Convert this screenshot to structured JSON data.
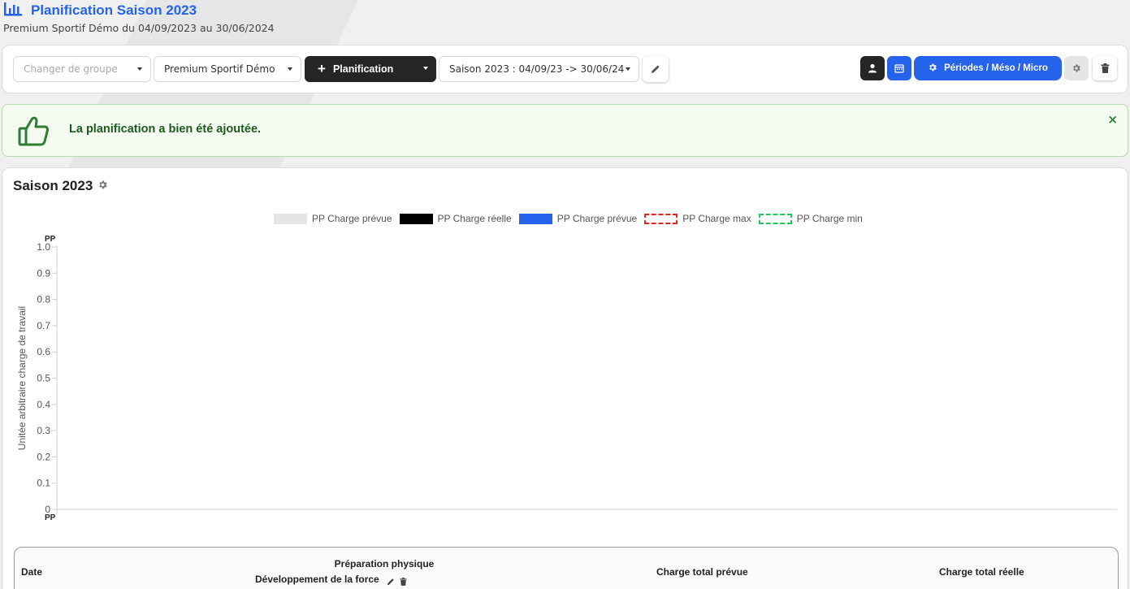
{
  "header": {
    "title": "Planification Saison 2023",
    "subtitle": "Premium Sportif Démo du 04/09/2023 au 30/06/2024"
  },
  "toolbar": {
    "group_select_placeholder": "Changer de groupe",
    "team_select_value": "Premium Sportif Démo",
    "planification_button_label": "Planification",
    "season_select_value": "Saison 2023 : 04/09/23 -> 30/06/24",
    "periods_button_label": "Périodes / Méso / Micro"
  },
  "alert": {
    "message": "La planification a bien été ajoutée.",
    "close_symbol": "×"
  },
  "card": {
    "title": "Saison 2023"
  },
  "chart_data": {
    "type": "bar",
    "title": "",
    "xlabel": "",
    "ylabel": "Unitée arbitraire charge de travail",
    "ylim": [
      0,
      1.0
    ],
    "y_ticks": [
      "0",
      "0.1",
      "0.2",
      "0.3",
      "0.4",
      "0.5",
      "0.6",
      "0.7",
      "0.8",
      "0.9",
      "1.0"
    ],
    "axis_top_label": "PP",
    "axis_bottom_label": "PP",
    "categories": [],
    "legend_position": "top-center",
    "series": [
      {
        "name": "PP Charge prévue",
        "color": "#e5e5e5",
        "style": "fill",
        "values": []
      },
      {
        "name": "PP Charge réelle",
        "color": "#000000",
        "style": "fill",
        "values": []
      },
      {
        "name": "PP Charge prévue",
        "color": "#2563eb",
        "style": "fill",
        "values": []
      },
      {
        "name": "PP Charge max",
        "color": "#e02424",
        "style": "dashed",
        "values": []
      },
      {
        "name": "PP Charge min",
        "color": "#22c55e",
        "style": "dashed",
        "values": []
      }
    ]
  },
  "table": {
    "columns": {
      "date": "Date",
      "prep_line1": "Préparation physique",
      "prep_line2": "Développement de la force",
      "charge_prevue": "Charge total prévue",
      "charge_reelle": "Charge total réelle"
    }
  },
  "colors": {
    "accent": "#2563eb",
    "dark": "#252525",
    "success_text": "#1d5a1d",
    "success_bg": "#f4fbf1"
  }
}
